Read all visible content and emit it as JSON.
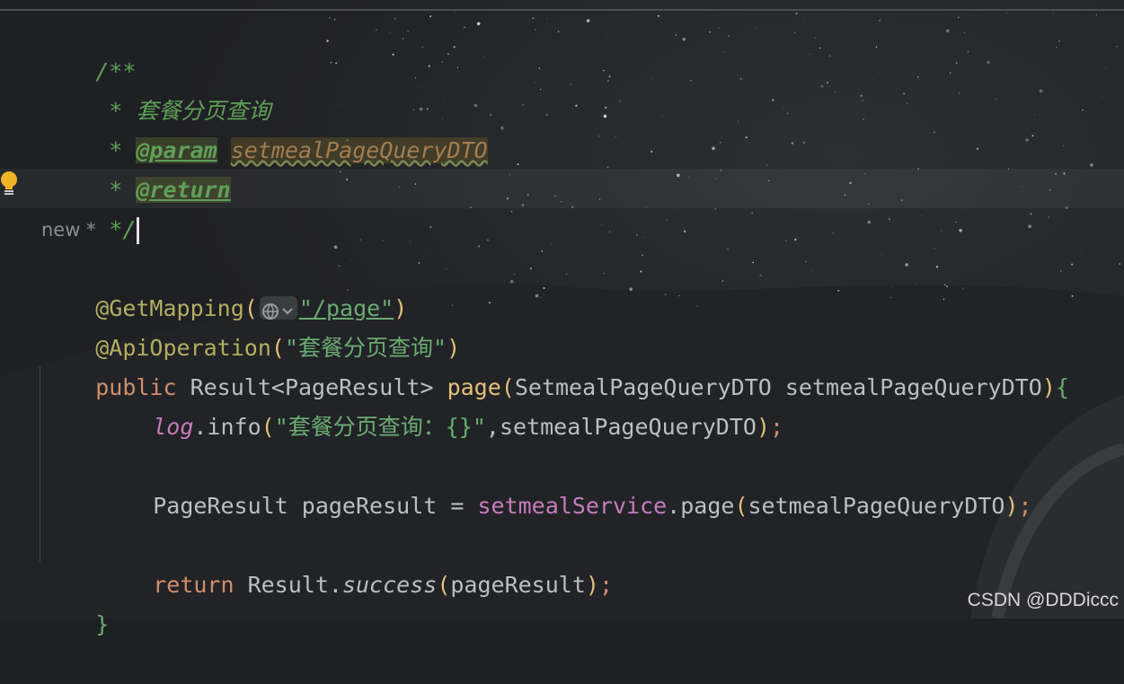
{
  "editor": {
    "lines": {
      "doc_open": "/**",
      "doc_desc": " * 套餐分页查询",
      "doc_param_star": " * ",
      "doc_param_tag": "@param",
      "doc_param_name": "setmealPageQueryDTO",
      "doc_return_star": " * ",
      "doc_return_tag": "@return",
      "doc_close": " */",
      "ann_getmapping": "@GetMapping",
      "ann_getmapping_path": "\"/page\"",
      "ann_apioperation": "@ApiOperation",
      "ann_apioperation_value": "\"套餐分页查询\"",
      "sig_public": "public",
      "sig_result": " Result<PageResult> ",
      "sig_method": "page",
      "sig_params": "SetmealPageQueryDTO setmealPageQueryDTO",
      "sig_open": "{",
      "log_obj": "log",
      "log_call": ".info",
      "log_string": "\"套餐分页查询：{}\"",
      "log_arg": ",setmealPageQueryDTO",
      "assign_left": "PageResult pageResult = ",
      "assign_field": "setmealService",
      "assign_call": ".page",
      "assign_arg": "setmealPageQueryDTO",
      "return_kw": "return",
      "return_obj": " Result.",
      "return_method": "success",
      "return_arg": "pageResult",
      "close_brace": "}"
    },
    "inlay_hint": "new *",
    "icons": {
      "intention": "lightbulb-icon",
      "url_chip": "globe-icon"
    }
  },
  "watermark": "CSDN @DDDiccc",
  "colors": {
    "background": "#1f2023",
    "comment": "#5f9f58",
    "keyword": "#cf8e6d",
    "annotation": "#b3ae60",
    "string": "#6aab73",
    "field": "#c77dbb",
    "text": "#bcbec4"
  }
}
